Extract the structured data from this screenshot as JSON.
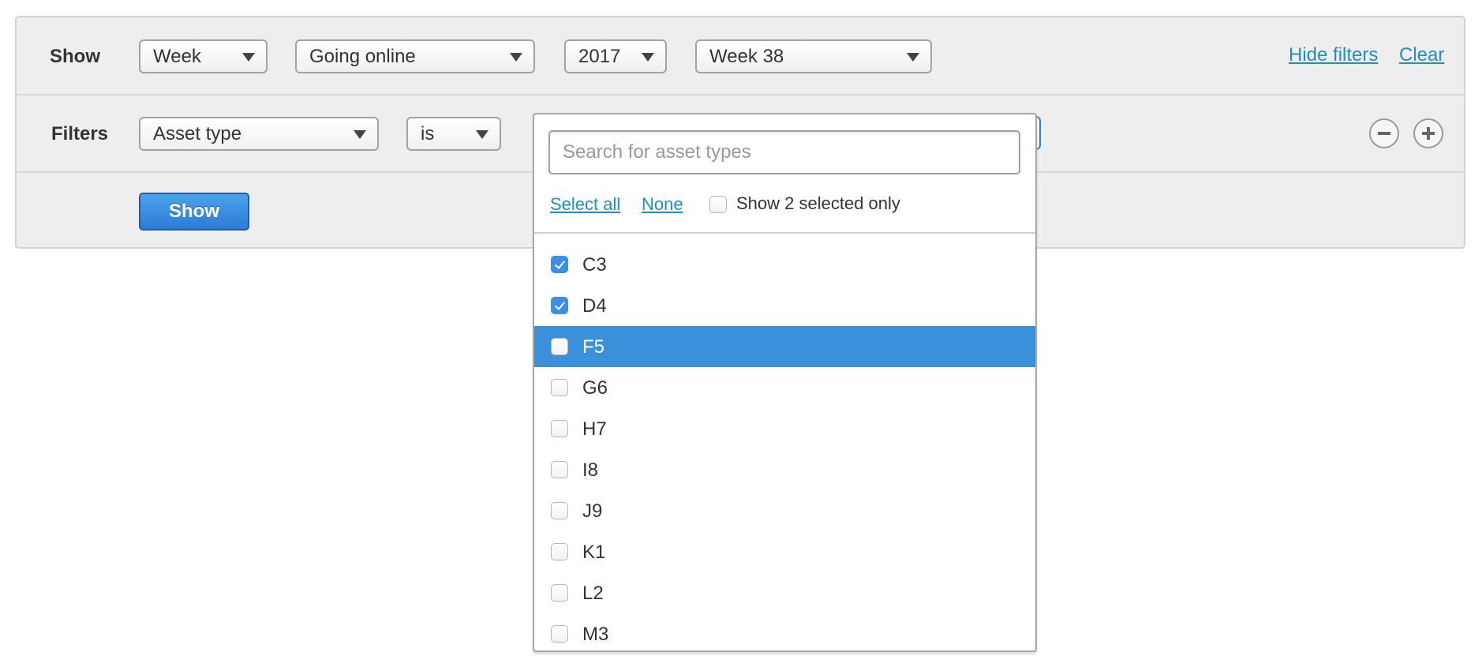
{
  "toolbar": {
    "show_label": "Show",
    "period_select": "Week",
    "metric_select": "Going online",
    "year_select": "2017",
    "week_select": "Week 38",
    "hide_filters_link": "Hide filters",
    "clear_link": "Clear"
  },
  "filters": {
    "label": "Filters",
    "field_select": "Asset type",
    "operator_select": "is",
    "remove_icon": "minus-circle-icon",
    "add_icon": "plus-circle-icon"
  },
  "show_button": "Show",
  "dropdown": {
    "search_placeholder": "Search for asset types",
    "search_value": "",
    "select_all": "Select all",
    "none": "None",
    "show_selected_only": "Show 2 selected only",
    "show_selected_only_checked": false,
    "items": [
      {
        "label": "C3",
        "checked": true,
        "highlighted": false
      },
      {
        "label": "D4",
        "checked": true,
        "highlighted": false
      },
      {
        "label": "F5",
        "checked": false,
        "highlighted": true
      },
      {
        "label": "G6",
        "checked": false,
        "highlighted": false
      },
      {
        "label": "H7",
        "checked": false,
        "highlighted": false
      },
      {
        "label": "I8",
        "checked": false,
        "highlighted": false
      },
      {
        "label": "J9",
        "checked": false,
        "highlighted": false
      },
      {
        "label": "K1",
        "checked": false,
        "highlighted": false
      },
      {
        "label": "L2",
        "checked": false,
        "highlighted": false
      },
      {
        "label": "M3",
        "checked": false,
        "highlighted": false
      }
    ]
  },
  "colors": {
    "accent": "#2c7ad6",
    "link": "#1e8fc6",
    "highlight": "#3b90dc"
  }
}
